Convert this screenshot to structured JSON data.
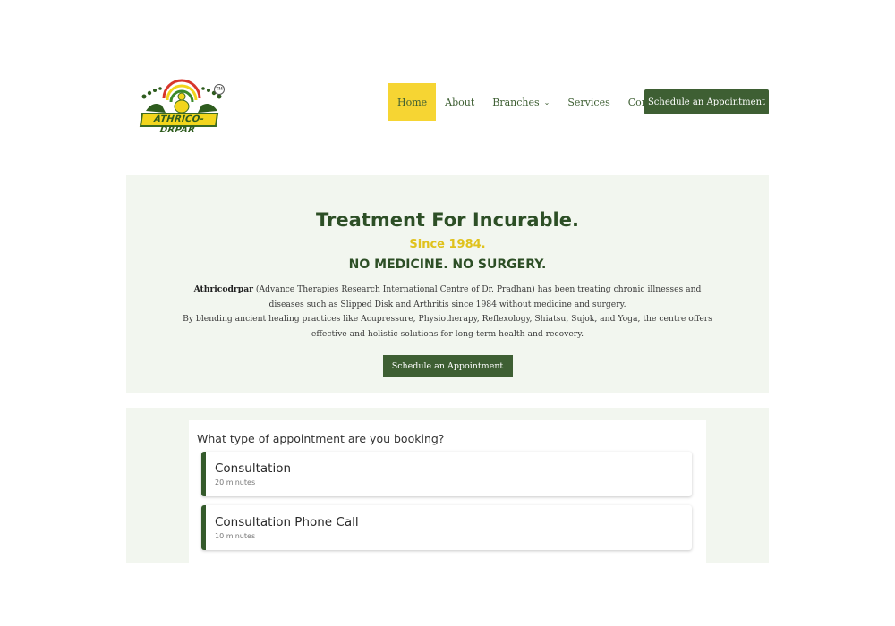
{
  "logo": {
    "text": "ATHRICO-DRPAR",
    "tm": "TM"
  },
  "nav": {
    "items": [
      {
        "label": "Home",
        "active": true
      },
      {
        "label": "About"
      },
      {
        "label": "Branches",
        "dropdown": true
      },
      {
        "label": "Services"
      },
      {
        "label": "Contact"
      }
    ],
    "cta_label": "Schedule an Appointment"
  },
  "hero": {
    "title": "Treatment For Incurable.",
    "since": "Since 1984.",
    "subtitle": "NO MEDICINE. NO SURGERY.",
    "desc_brand": "Athricodrpar",
    "desc_line1": " (Advance Therapies Research International Centre of Dr. Pradhan) has been treating chronic illnesses and diseases such as Slipped Disk and Arthritis since 1984 without medicine and surgery.",
    "desc_line2": "By blending ancient healing practices like Acupressure, Physiotherapy, Reflexology, Shiatsu, Sujok, and Yoga, the centre offers effective and holistic solutions for long-term health and recovery.",
    "cta_label": "Schedule an Appointment"
  },
  "booking": {
    "question": "What type of appointment are you booking?",
    "types": [
      {
        "title": "Consultation",
        "duration": "20 minutes"
      },
      {
        "title": "Consultation Phone Call",
        "duration": "10 minutes"
      }
    ]
  },
  "colors": {
    "primary_green": "#3e5f33",
    "accent_yellow": "#f6d533",
    "section_bg": "#f2f6ef"
  }
}
